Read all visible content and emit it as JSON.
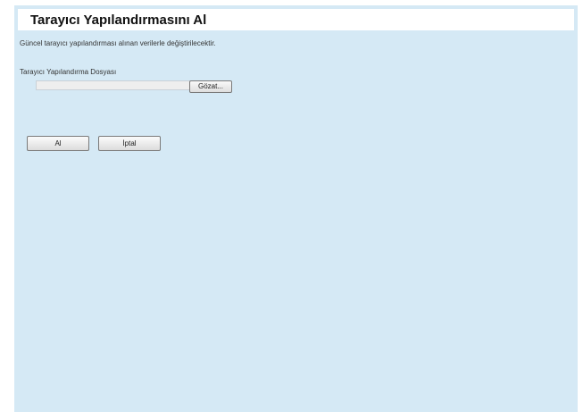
{
  "header": {
    "title": "Tarayıcı Yapılandırmasını Al"
  },
  "main": {
    "description": "Güncel tarayıcı yapılandırması alınan verilerle değiştirilecektir.",
    "file_field": {
      "label": "Tarayıcı Yapılandırma Dosyası",
      "value": "",
      "browse_label": "Gözat..."
    },
    "actions": {
      "ok_label": "Al",
      "cancel_label": "İptal"
    }
  },
  "colors": {
    "background": "#d5e9f5",
    "title_bar": "#ffffff"
  }
}
